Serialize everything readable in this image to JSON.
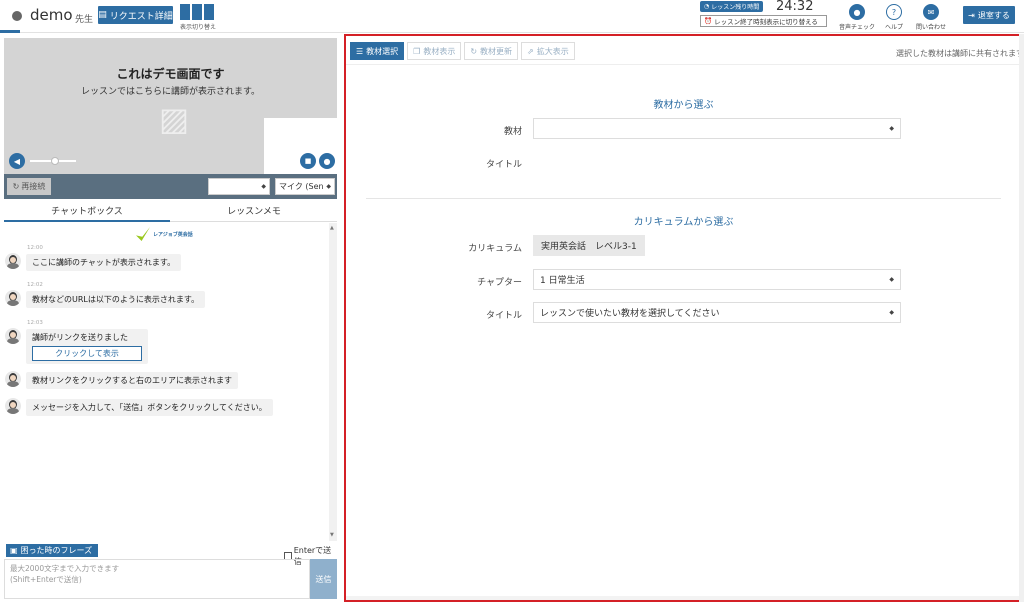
{
  "header": {
    "user_name": "demo",
    "user_suffix": "先生",
    "request_button": "リクエスト詳細",
    "layout_toggle_label": "表示切り替え",
    "timer_badge": "レッスン残り時間",
    "timer_value": "24:32",
    "timer_switch": "レッスン終了時刻表示に切り替える",
    "audio_check": "音声チェック",
    "help": "ヘルプ",
    "contact": "問い合わせ",
    "exit_button": "退室する"
  },
  "video": {
    "title": "これはデモ画面です",
    "subtitle": "レッスンではこちらに講師が表示されます。"
  },
  "controls": {
    "reconnect": "再接続",
    "speaker_select": "",
    "mic_select": "マイク (Sen"
  },
  "chat_tabs": [
    "チャットボックス",
    "レッスンメモ"
  ],
  "chat": {
    "logo_text": "レアジョブ英会話",
    "messages": [
      {
        "time": "12:00",
        "text": "ここに講師のチャットが表示されます。"
      },
      {
        "time": "12:02",
        "text": "教材などのURLは以下のように表示されます。"
      },
      {
        "time": "12:03",
        "text": "講師がリンクを送りました",
        "link": "クリックして表示"
      },
      {
        "time": "",
        "text": "教材リンクをクリックすると右のエリアに表示されます"
      },
      {
        "time": "",
        "text": "メッセージを入力して、「送信」ボタンをクリックしてください。"
      }
    ],
    "phrase_button": "困った時のフレーズ",
    "enter_send": "Enterで送信",
    "input_placeholder_1": "最大2000文字まで入力できます",
    "input_placeholder_2": "(Shift+Enterで送信)",
    "send_button": "送信"
  },
  "material": {
    "toolbar": [
      "教材選択",
      "教材表示",
      "教材更新",
      "拡大表示"
    ],
    "share_note": "選択した教材は講師に共有されます",
    "section1_title": "教材から選ぶ",
    "label_material": "教材",
    "material_value": "",
    "label_title1": "タイトル",
    "section2_title": "カリキュラムから選ぶ",
    "label_curriculum": "カリキュラム",
    "curriculum_value": "実用英会話　レベル3-1",
    "label_chapter": "チャプター",
    "chapter_value": "1 日常生活",
    "label_title2": "タイトル",
    "title2_value": "レッスンで使いたい教材を選択してください"
  },
  "colors": {
    "accent": "#2d6da3",
    "highlight_border": "#d42026"
  }
}
